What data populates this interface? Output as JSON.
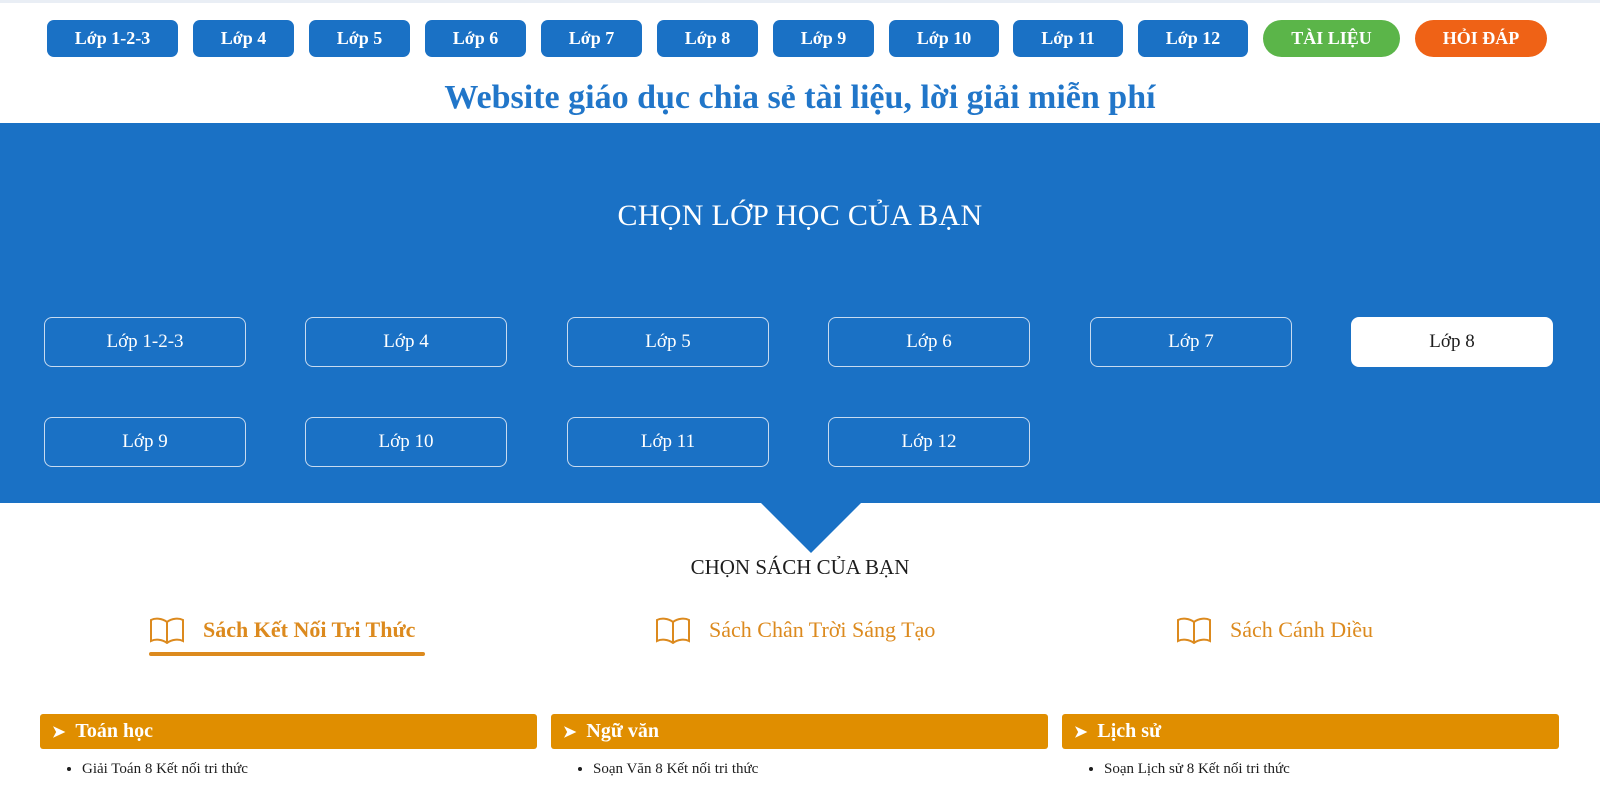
{
  "top_nav": [
    {
      "label": "Lớp 1-2-3"
    },
    {
      "label": "Lớp 4"
    },
    {
      "label": "Lớp 5"
    },
    {
      "label": "Lớp 6"
    },
    {
      "label": "Lớp 7"
    },
    {
      "label": "Lớp 8"
    },
    {
      "label": "Lớp 9"
    },
    {
      "label": "Lớp 10"
    },
    {
      "label": "Lớp 11"
    },
    {
      "label": "Lớp 12"
    },
    {
      "label": "TÀI LIỆU"
    },
    {
      "label": "HỎI ĐÁP"
    }
  ],
  "headline": "Website giáo dục chia sẻ tài liệu, lời giải miễn phí",
  "hero": {
    "title": "CHỌN LỚP HỌC CỦA BẠN",
    "grades": [
      "Lớp 1-2-3",
      "Lớp 4",
      "Lớp 5",
      "Lớp 6",
      "Lớp 7",
      "Lớp 8",
      "Lớp 9",
      "Lớp 10",
      "Lớp 11",
      "Lớp 12"
    ],
    "selected_grade": "Lớp 8"
  },
  "books": {
    "title": "CHỌN SÁCH CỦA BẠN",
    "tabs": [
      {
        "label": "Sách Kết Nối Tri Thức",
        "icon": "book-icon"
      },
      {
        "label": "Sách Chân Trời Sáng Tạo",
        "icon": "book-icon"
      },
      {
        "label": "Sách Cánh Diều",
        "icon": "book-icon"
      }
    ],
    "active_tab": "Sách Kết Nối Tri Thức"
  },
  "subjects": [
    {
      "name": "Toán học",
      "items": [
        "Giải Toán 8 Kết nối tri thức"
      ]
    },
    {
      "name": "Ngữ văn",
      "items": [
        "Soạn Văn 8 Kết nối tri thức"
      ]
    },
    {
      "name": "Lịch sử",
      "items": [
        "Soạn Lịch sử 8 Kết nối tri thức"
      ]
    }
  ],
  "colors": {
    "primary_blue": "#1a71c5",
    "green": "#5bb549",
    "orange": "#ef6216",
    "book_orange": "#dc8a1e",
    "subject_bar": "#e08e00"
  }
}
